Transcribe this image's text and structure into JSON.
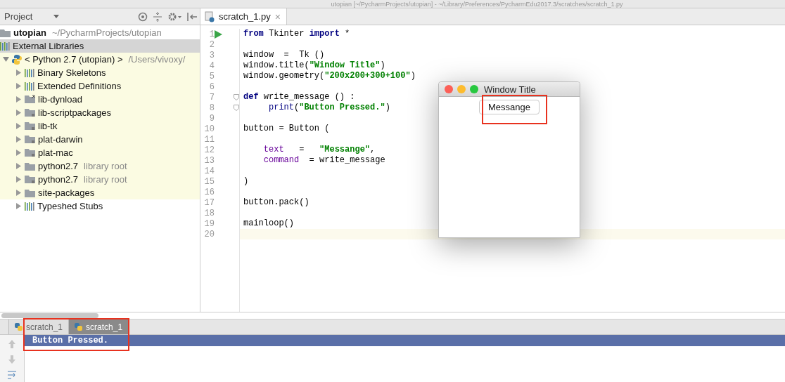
{
  "title_bar": {
    "text": "utopian [~/PycharmProjects/utopian] - ~/Library/Preferences/PycharmEdu2017.3/scratches/scratch_1.py"
  },
  "project_panel": {
    "title": "Project",
    "tree": [
      {
        "name": "utopian",
        "hint": "~/PycharmProjects/utopian",
        "kind": "folder",
        "bold": true,
        "selected": false,
        "highlighted": false
      },
      {
        "name": "External Libraries",
        "kind": "bars",
        "selected": true,
        "highlighted": false,
        "children": [
          {
            "name": "< Python 2.7 (utopian) >",
            "hint": "/Users/vivoxy/",
            "kind": "python",
            "expanded": true,
            "selected": false,
            "highlighted": true,
            "children": [
              {
                "name": "Binary Skeletons",
                "kind": "bars",
                "expanded": false,
                "selected": false,
                "highlighted": true
              },
              {
                "name": "Extended Definitions",
                "kind": "bars",
                "expanded": false,
                "selected": false,
                "highlighted": true
              },
              {
                "name": "lib-dynload",
                "kind": "folder-link",
                "expanded": false,
                "selected": false,
                "highlighted": true
              },
              {
                "name": "lib-scriptpackages",
                "kind": "folder-lock",
                "expanded": false,
                "selected": false,
                "highlighted": true
              },
              {
                "name": "lib-tk",
                "kind": "folder-lock",
                "expanded": false,
                "selected": false,
                "highlighted": true
              },
              {
                "name": "plat-darwin",
                "kind": "folder-lock",
                "expanded": false,
                "selected": false,
                "highlighted": true
              },
              {
                "name": "plat-mac",
                "kind": "folder-lock",
                "expanded": false,
                "selected": false,
                "highlighted": true
              },
              {
                "name": "python2.7",
                "hint": "library root",
                "kind": "folder",
                "expanded": false,
                "selected": false,
                "highlighted": true
              },
              {
                "name": "python2.7",
                "hint": "library root",
                "kind": "folder-lock",
                "expanded": false,
                "selected": false,
                "highlighted": true
              },
              {
                "name": "site-packages",
                "kind": "folder",
                "expanded": false,
                "selected": false,
                "highlighted": true
              },
              {
                "name": "Typeshed Stubs",
                "kind": "bars",
                "expanded": false,
                "selected": false,
                "highlighted": false
              }
            ]
          }
        ]
      }
    ]
  },
  "editor": {
    "tabs": [
      {
        "label": "scratch_1.py",
        "close": "×",
        "selected": true
      }
    ],
    "lines": [
      {
        "number": "1",
        "run": true,
        "tokens": [
          {
            "kind": "kw",
            "text": "from"
          },
          {
            "kind": "plain",
            "text": " Tkinter "
          },
          {
            "kind": "kw",
            "text": "import"
          },
          {
            "kind": "plain",
            "text": " *"
          }
        ]
      },
      {
        "number": "2"
      },
      {
        "number": "3",
        "tokens": [
          {
            "kind": "plain",
            "text": "window  =  Tk ()"
          }
        ]
      },
      {
        "number": "4",
        "tokens": [
          {
            "kind": "plain",
            "text": "window.title("
          },
          {
            "kind": "str",
            "text": "\"Window Title\""
          },
          {
            "kind": "plain",
            "text": ")"
          }
        ]
      },
      {
        "number": "5",
        "tokens": [
          {
            "kind": "plain",
            "text": "window.geometry("
          },
          {
            "kind": "str",
            "text": "\"200x200+300+100\""
          },
          {
            "kind": "plain",
            "text": ")"
          }
        ]
      },
      {
        "number": "6"
      },
      {
        "number": "7",
        "fold": true,
        "tokens": [
          {
            "kind": "kw",
            "text": "def"
          },
          {
            "kind": "plain",
            "text": " write_message () :"
          }
        ]
      },
      {
        "number": "8",
        "fold": true,
        "tokens": [
          {
            "kind": "builtin",
            "text": "     print"
          },
          {
            "kind": "plain",
            "text": "("
          },
          {
            "kind": "str",
            "text": "\"Button Pressed.\""
          },
          {
            "kind": "plain",
            "text": ")"
          }
        ]
      },
      {
        "number": "9"
      },
      {
        "number": "10",
        "tokens": [
          {
            "kind": "plain",
            "text": "button = Button ("
          }
        ]
      },
      {
        "number": "11"
      },
      {
        "number": "12",
        "tokens": [
          {
            "kind": "param",
            "text": "    text"
          },
          {
            "kind": "plain",
            "text": "   =   "
          },
          {
            "kind": "str",
            "text": "\"Messange\""
          },
          {
            "kind": "plain",
            "text": ","
          }
        ]
      },
      {
        "number": "13",
        "tokens": [
          {
            "kind": "param",
            "text": "    command"
          },
          {
            "kind": "plain",
            "text": "  = write_message"
          }
        ]
      },
      {
        "number": "14"
      },
      {
        "number": "15",
        "tokens": [
          {
            "kind": "plain",
            "text": ")"
          }
        ]
      },
      {
        "number": "16"
      },
      {
        "number": "17",
        "tokens": [
          {
            "kind": "plain",
            "text": "button.pack()"
          }
        ]
      },
      {
        "number": "18"
      },
      {
        "number": "19",
        "tokens": [
          {
            "kind": "plain",
            "text": "mainloop()"
          }
        ]
      },
      {
        "number": "20",
        "current": true
      }
    ]
  },
  "tk_window": {
    "title": "Window Title",
    "button": {
      "label": "Messange",
      "annotated": true
    }
  },
  "run_panel": {
    "tabs": [
      {
        "label": "scratch_1",
        "selected": false
      },
      {
        "label": "scratch_1",
        "selected": true
      }
    ],
    "output": [
      {
        "text": "Button Pressed.",
        "selected": true
      }
    ],
    "annotated": true
  }
}
